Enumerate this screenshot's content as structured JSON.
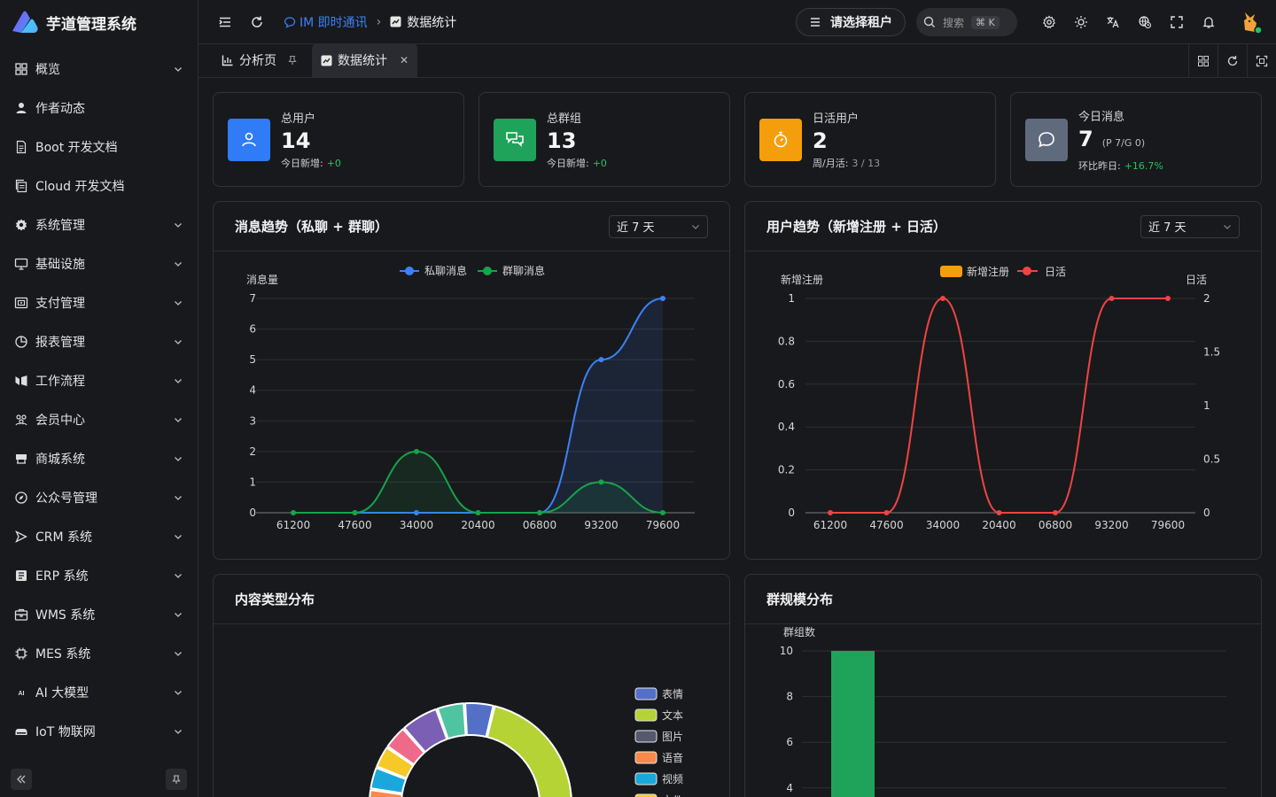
{
  "app": {
    "title": "芋道管理系统"
  },
  "sidebar": {
    "items": [
      {
        "label": "概览",
        "icon": "grid-icon",
        "expandable": true
      },
      {
        "label": "作者动态",
        "icon": "user-icon",
        "expandable": false
      },
      {
        "label": "Boot 开发文档",
        "icon": "doc-icon",
        "expandable": false
      },
      {
        "label": "Cloud 开发文档",
        "icon": "doc-copy-icon",
        "expandable": false
      },
      {
        "label": "系统管理",
        "icon": "gear-icon",
        "expandable": true
      },
      {
        "label": "基础设施",
        "icon": "monitor-icon",
        "expandable": true
      },
      {
        "label": "支付管理",
        "icon": "payment-icon",
        "expandable": true
      },
      {
        "label": "报表管理",
        "icon": "pie-icon",
        "expandable": true
      },
      {
        "label": "工作流程",
        "icon": "workflow-icon",
        "expandable": true
      },
      {
        "label": "会员中心",
        "icon": "members-icon",
        "expandable": true
      },
      {
        "label": "商城系统",
        "icon": "shop-icon",
        "expandable": true
      },
      {
        "label": "公众号管理",
        "icon": "compass-icon",
        "expandable": true
      },
      {
        "label": "CRM 系统",
        "icon": "crm-icon",
        "expandable": true
      },
      {
        "label": "ERP 系统",
        "icon": "erp-icon",
        "expandable": true
      },
      {
        "label": "WMS 系统",
        "icon": "warehouse-icon",
        "expandable": true
      },
      {
        "label": "MES 系统",
        "icon": "chip-icon",
        "expandable": true
      },
      {
        "label": "AI 大模型",
        "icon": "ai-icon",
        "expandable": true
      },
      {
        "label": "IoT 物联网",
        "icon": "iot-icon",
        "expandable": true
      }
    ]
  },
  "header": {
    "breadcrumb": {
      "parent": "IM 即时通讯",
      "current": "数据统计"
    },
    "tenant_label": "请选择租户",
    "search": {
      "placeholder": "搜索",
      "shortcut": "⌘ K"
    }
  },
  "tabs": [
    {
      "label": "分析页",
      "active": false
    },
    {
      "label": "数据统计",
      "active": true
    }
  ],
  "stats": [
    {
      "title": "总用户",
      "value": "14",
      "extra": "",
      "sub_label": "今日新增:",
      "sub_value": "+0",
      "sub_style": "g",
      "color": "#2f7cf6",
      "icon": "user-icon"
    },
    {
      "title": "总群组",
      "value": "13",
      "extra": "",
      "sub_label": "今日新增:",
      "sub_value": "+0",
      "sub_style": "g",
      "color": "#1fa35b",
      "icon": "chat-bubbles-icon"
    },
    {
      "title": "日活用户",
      "value": "2",
      "extra": "",
      "sub_label": "周/月活:",
      "sub_value": "3 / 13",
      "sub_style": "muted",
      "color": "#f59e0b",
      "icon": "stopwatch-icon"
    },
    {
      "title": "今日消息",
      "value": "7",
      "extra": "(P 7/G 0)",
      "sub_label": "环比昨日:",
      "sub_value": "+16.7%",
      "sub_style": "g",
      "color": "#5f6b7d",
      "icon": "message-icon"
    }
  ],
  "panels": {
    "message_trend": {
      "title": "消息趋势（私聊 + 群聊）",
      "range": "近 7 天"
    },
    "user_trend": {
      "title": "用户趋势（新增注册 + 日活）",
      "range": "近 7 天"
    },
    "content_dist": {
      "title": "内容类型分布"
    },
    "group_dist": {
      "title": "群规模分布"
    }
  },
  "chart_data": [
    {
      "type": "line",
      "title": "",
      "ylabel": "消息量",
      "categories": [
        "61200",
        "47600",
        "34000",
        "20400",
        "06800",
        "93200",
        "79600"
      ],
      "ylim": [
        0,
        7
      ],
      "legend_position": "top",
      "series": [
        {
          "name": "私聊消息",
          "values": [
            0,
            0,
            0,
            0,
            0,
            5,
            7
          ],
          "color": "#3b82f6"
        },
        {
          "name": "群聊消息",
          "values": [
            0,
            0,
            2,
            0,
            0,
            1,
            0
          ],
          "color": "#16a34a"
        }
      ]
    },
    {
      "type": "line",
      "title": "",
      "ylabel": "新增注册",
      "ylabel_right": "日活",
      "categories": [
        "61200",
        "47600",
        "34000",
        "20400",
        "06800",
        "93200",
        "79600"
      ],
      "ylim": [
        0,
        1
      ],
      "ylim_right": [
        0,
        2
      ],
      "legend_position": "top",
      "series": [
        {
          "name": "新增注册",
          "values": [
            0,
            0,
            0,
            0,
            0,
            0,
            0
          ],
          "color": "#f59e0b",
          "axis": "left",
          "style": "bar"
        },
        {
          "name": "日活",
          "values": [
            0,
            0,
            2,
            0,
            0,
            2,
            2
          ],
          "color": "#ef4444",
          "axis": "right"
        }
      ]
    },
    {
      "type": "pie",
      "title": "",
      "legend_position": "right",
      "slices": [
        {
          "name": "表情",
          "color": "#5470c6",
          "value": 1
        },
        {
          "name": "文本",
          "color": "#b5d334",
          "value": 7
        },
        {
          "name": "图片",
          "color": "#54596e",
          "value": 0
        },
        {
          "name": "语音",
          "color": "#f68a4a",
          "value": 1
        },
        {
          "name": "视频",
          "color": "#1aa8dc",
          "value": 1
        },
        {
          "name": "文件",
          "color": "#f6c928",
          "value": 1
        }
      ],
      "extra_slice_colors": [
        "#f6c928",
        "#ef6a8a",
        "#7b5fb5",
        "#4ec4a0"
      ]
    },
    {
      "type": "bar",
      "title": "",
      "ylabel": "群组数",
      "categories": [
        ""
      ],
      "values": [
        10
      ],
      "ylim": [
        0,
        10
      ],
      "yticks_visible": [
        10,
        8,
        6,
        4
      ],
      "color": "#1fa35b"
    }
  ]
}
